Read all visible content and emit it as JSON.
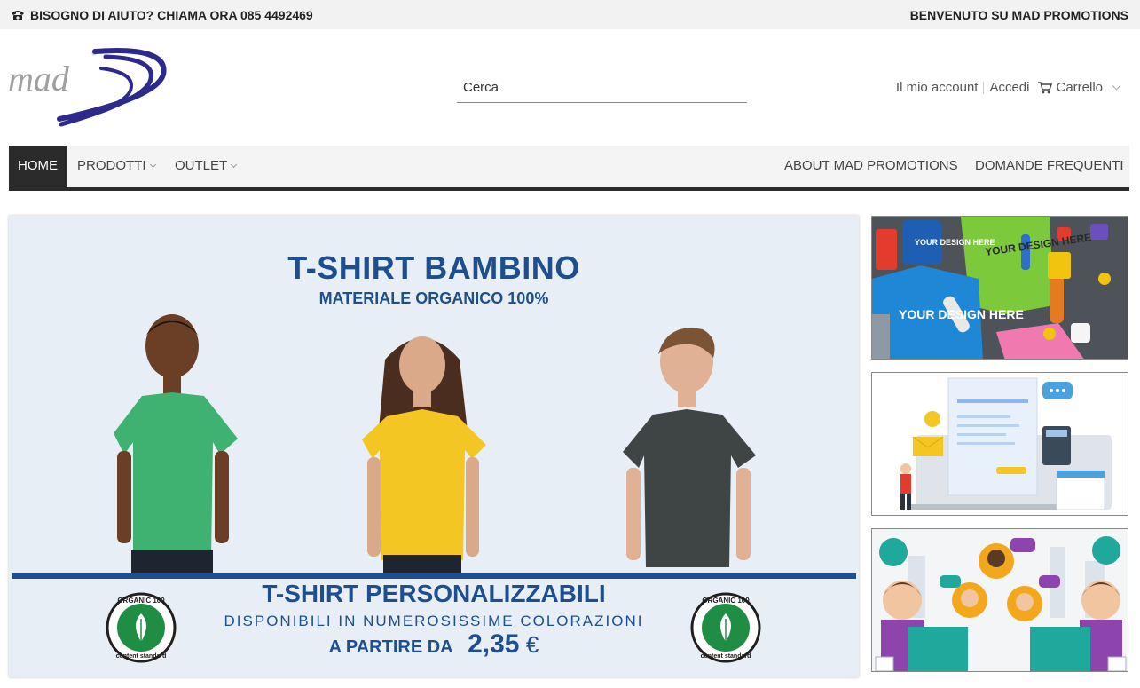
{
  "topbar": {
    "help_text": "BISOGNO DI AIUTO? CHIAMA ORA 085 4492469",
    "welcome_text": "BENVENUTO SU MAD PROMOTIONS",
    "phone_icon": "phone-icon"
  },
  "header": {
    "logo_text": "mad",
    "search_placeholder": "Cerca",
    "my_account": "Il mio account",
    "login": "Accedi",
    "cart": "Carrello",
    "cart_icon": "cart-icon"
  },
  "nav": {
    "home": "HOME",
    "products": "PRODOTTI",
    "outlet": "OUTLET",
    "about": "ABOUT MAD PROMOTIONS",
    "faq": "DOMANDE FREQUENTI"
  },
  "banner": {
    "title": "T-SHIRT BAMBINO",
    "subtitle": "MATERIALE ORGANICO 100%",
    "title2": "T-SHIRT PERSONALIZZABILI",
    "line2": "DISPONIBILI IN NUMEROSISSIME COLORAZIONI",
    "price_prefix": "A PARTIRE DA",
    "price": "2,35",
    "currency": "€",
    "badge_top": "ORGANIC 100",
    "badge_bottom": "content standard"
  },
  "side_images": {
    "promo_text": "YOUR DESIGN HERE"
  },
  "colors": {
    "brand_blue": "#1d4f8f",
    "nav_dark": "#2b2b2b",
    "shirt_green": "#3fb271",
    "shirt_yellow": "#f3c623",
    "shirt_grey": "#3f4444"
  }
}
